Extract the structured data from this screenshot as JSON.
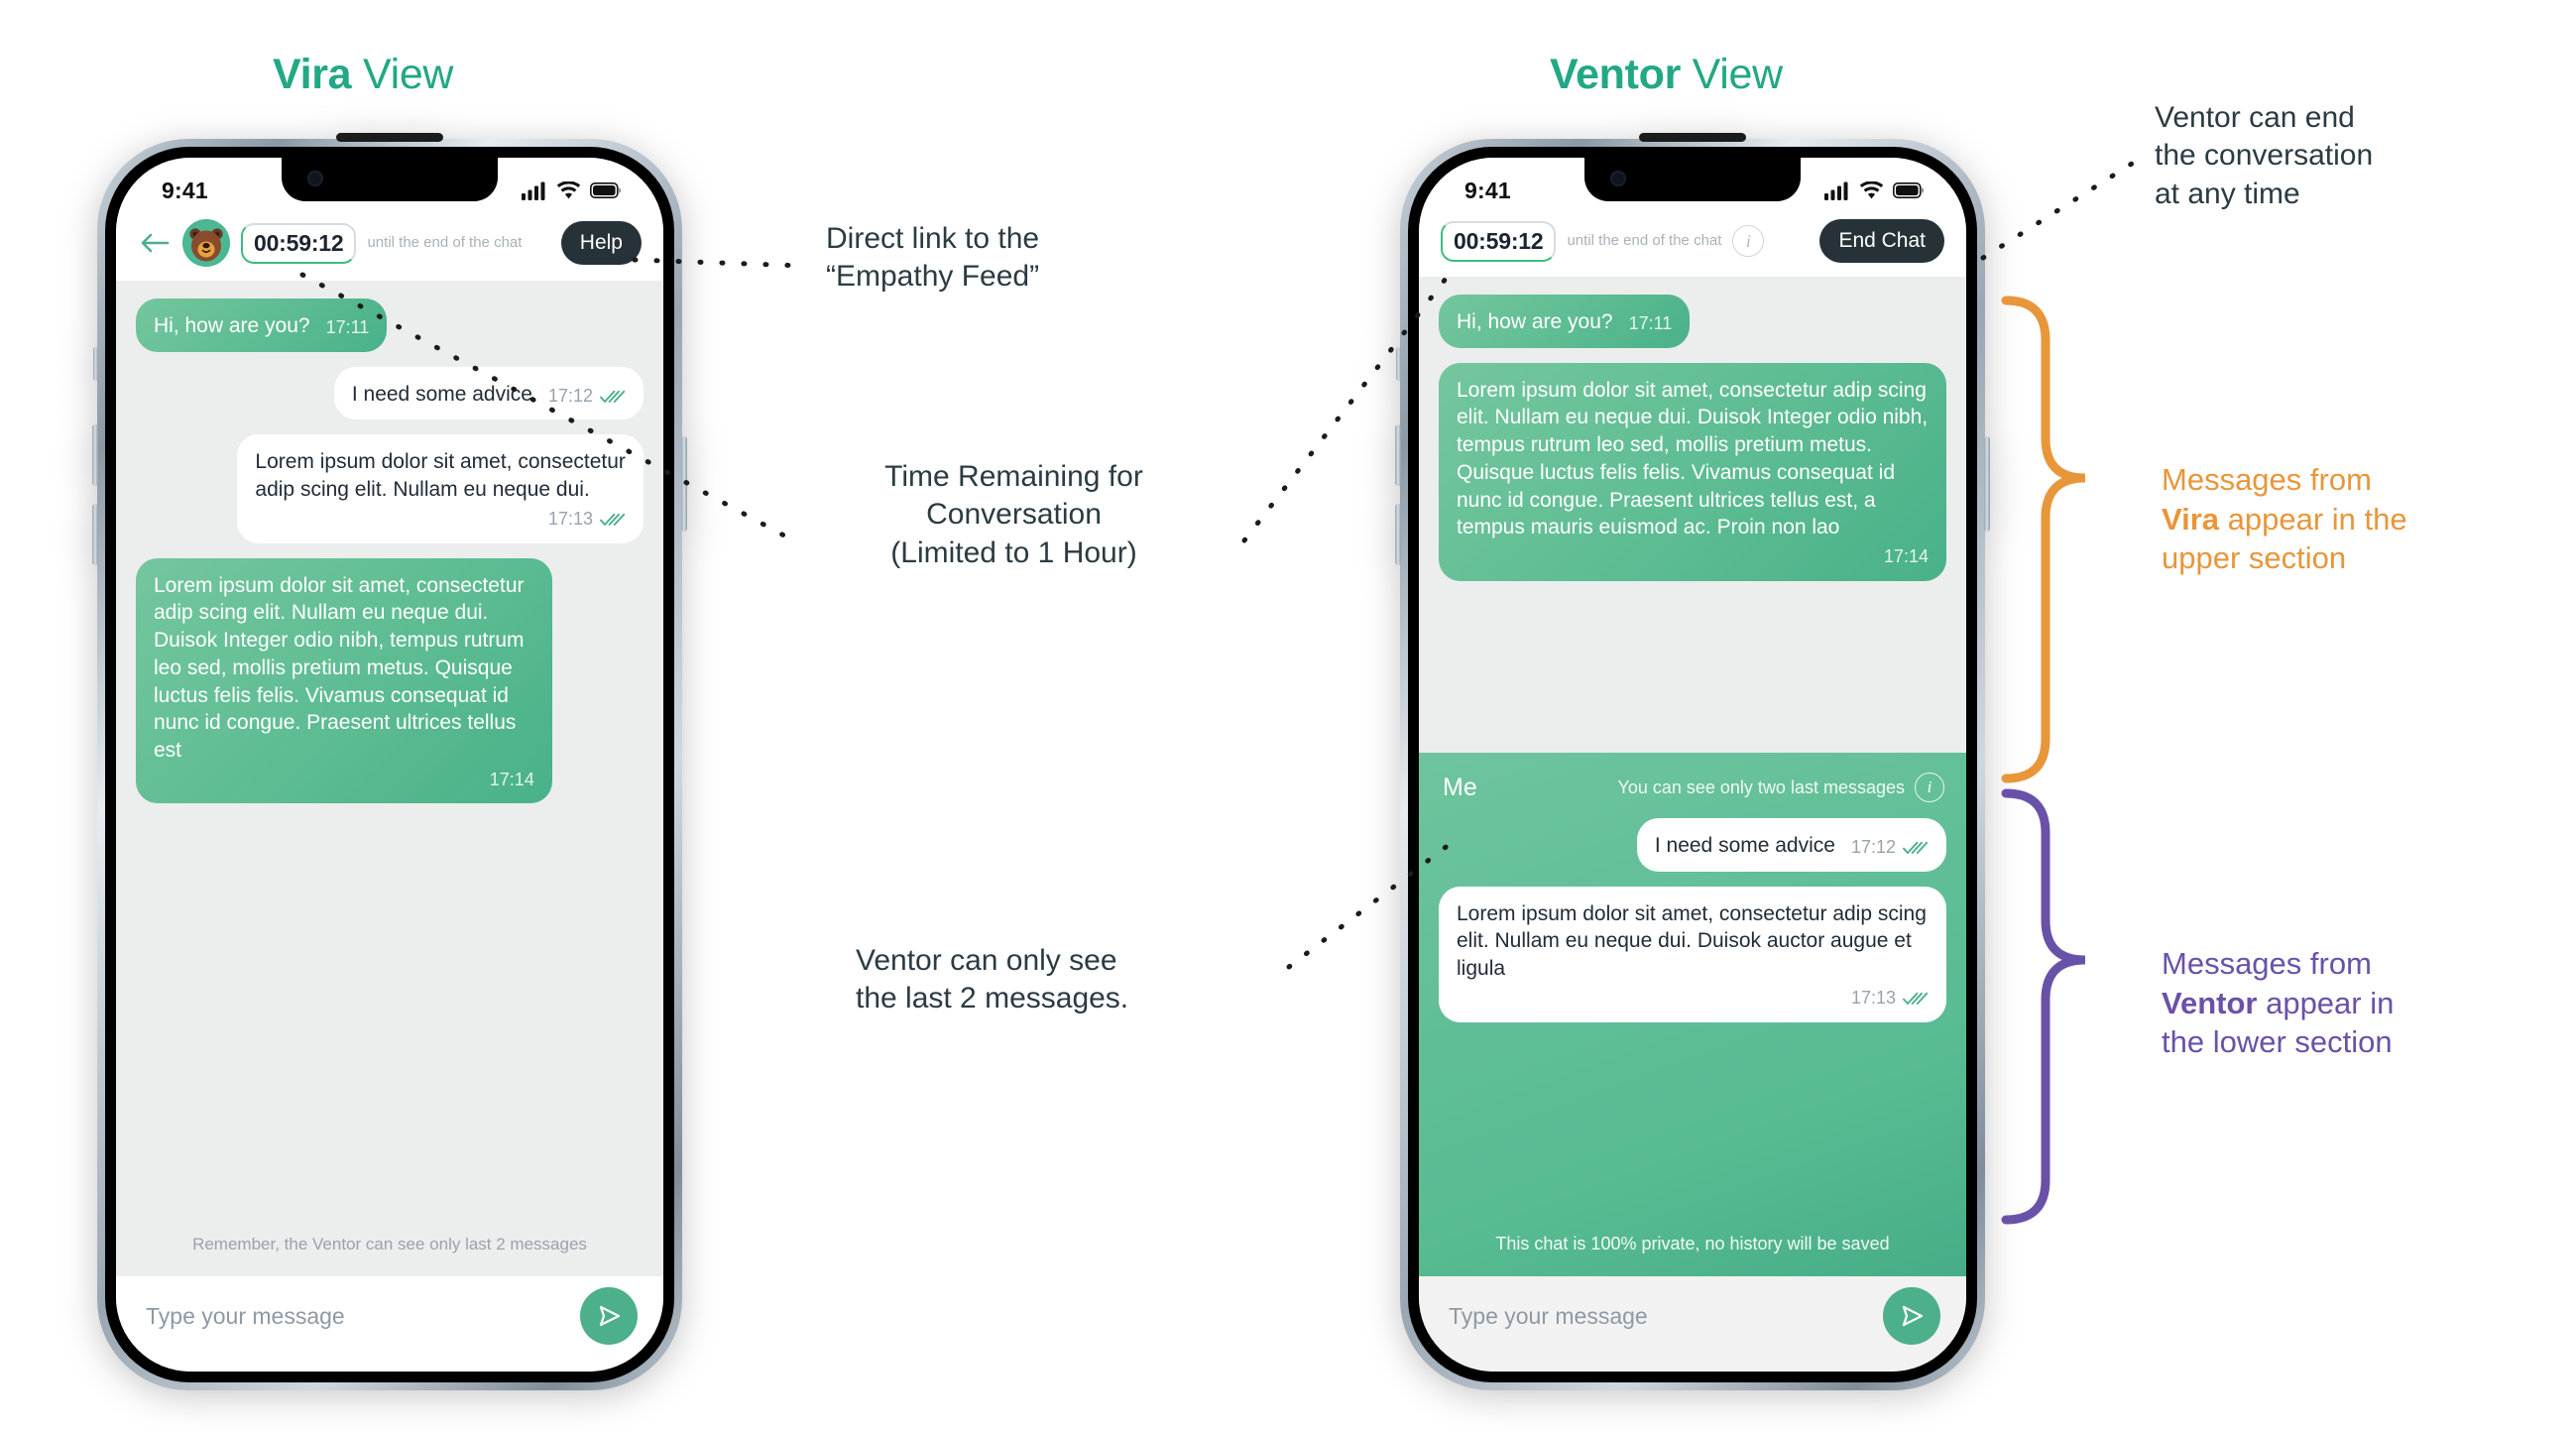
{
  "titles": {
    "left_bold": "Vira",
    "left_rest": " View",
    "right_bold": "Ventor",
    "right_rest": " View"
  },
  "phone_left": {
    "status": {
      "time": "9:41"
    },
    "header": {
      "back_icon": "back-arrow-icon",
      "avatar_icon": "bear-avatar",
      "timer": "00:59:12",
      "timer_caption": "until  the end\nof the chat",
      "action_label": "Help"
    },
    "messages": [
      {
        "side": "in",
        "text": "Hi, how are you?",
        "time": "17:11",
        "ticks": false,
        "inline": true
      },
      {
        "side": "out",
        "text": "I need some advice",
        "time": "17:12",
        "ticks": true,
        "inline": true
      },
      {
        "side": "out",
        "text": "Lorem ipsum dolor sit amet, consectetur adip scing elit. Nullam eu neque dui.",
        "time": "17:13",
        "ticks": true,
        "inline": false
      },
      {
        "side": "in",
        "text": "Lorem ipsum dolor sit amet, consectetur adip scing elit. Nullam eu neque dui. Duisok Integer odio nibh, tempus rutrum leo sed, mollis pretium metus. Quisque luctus felis felis. Vivamus consequat id nunc id congue. Praesent ultrices tellus est",
        "time": "17:14",
        "ticks": false,
        "inline": false
      }
    ],
    "footer_note": "Remember, the Ventor can see only last 2 messages",
    "input_placeholder": "Type your message",
    "send_icon": "send-icon"
  },
  "phone_right": {
    "status": {
      "time": "9:41"
    },
    "header": {
      "timer": "00:59:12",
      "timer_caption": "until  the end\nof the chat",
      "info_icon": "info-icon",
      "action_label": "End Chat"
    },
    "upper_messages": [
      {
        "side": "in",
        "text": "Hi, how are you?",
        "time": "17:11",
        "ticks": false,
        "inline": true
      },
      {
        "side": "in",
        "text": "Lorem ipsum dolor sit amet, consectetur adip scing elit. Nullam eu neque dui. Duisok Integer odio nibh, tempus rutrum leo sed, mollis pretium metus. Quisque luctus felis felis. Vivamus consequat id nunc id congue. Praesent ultrices tellus est, a tempus mauris euismod ac. Proin non lao",
        "time": "17:14",
        "ticks": false,
        "inline": false
      }
    ],
    "me_section": {
      "label": "Me",
      "hint": "You can see only two last messages",
      "info_icon": "info-icon",
      "messages": [
        {
          "side": "out",
          "text": "I need some advice",
          "time": "17:12",
          "ticks": true,
          "inline": true
        },
        {
          "side": "out",
          "text": "Lorem ipsum dolor sit amet, consectetur adip scing elit. Nullam eu neque dui. Duisok auctor augue et ligula",
          "time": "17:13",
          "ticks": true,
          "inline": false
        }
      ],
      "footer_note": "This chat is 100% private, no history will be saved"
    },
    "input_placeholder": "Type your message",
    "send_icon": "send-icon"
  },
  "annotations": {
    "empathy_feed": "Direct link to the\n“Empathy Feed”",
    "time_remaining": "Time Remaining for\nConversation\n(Limited to 1 Hour)",
    "last_two": "Ventor can only see\nthe last 2 messages.",
    "end_chat": "Ventor can end\nthe conversation\nat any time",
    "upper_prefix": "Messages from\n",
    "upper_bold": "Vira",
    "upper_suffix": " appear in the\nupper section",
    "lower_prefix": "Messages from\n",
    "lower_bold": "Ventor",
    "lower_suffix": " appear in\nthe lower section"
  },
  "colors": {
    "accent_green": "#22a884",
    "bubble_green": "#5fbd93",
    "orange": "#e8963a",
    "purple": "#6a51a8",
    "dark": "#263238"
  }
}
